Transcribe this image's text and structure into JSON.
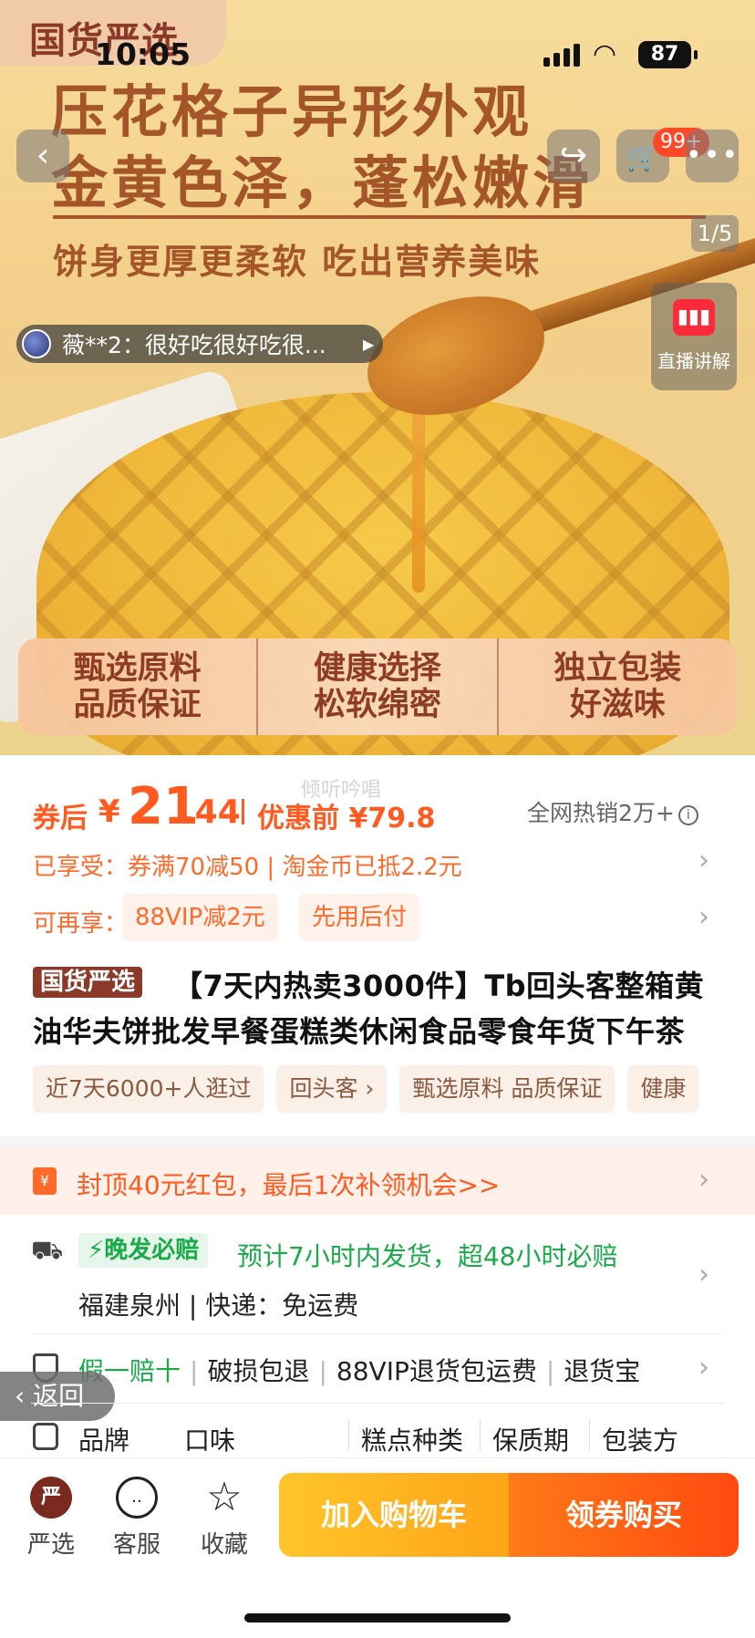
{
  "status_bar": {
    "time": "10:05",
    "battery": "87"
  },
  "hero": {
    "brand": "国货严选",
    "headline_1": "压花格子异形外观",
    "headline_2": "金黄色泽，蓬松嫩滑",
    "subheadline": "饼身更厚更柔软 吃出营养美味",
    "cart_badge": "99+",
    "page_counter": "1/5",
    "review": "薇**2：很好吃很好吃很...",
    "live_label": "直播讲解",
    "features": [
      {
        "line1": "甄选原料",
        "line2": "品质保证"
      },
      {
        "line1": "健康选择",
        "line2": "松软绵密"
      },
      {
        "line1": "独立包装",
        "line2": "好滋味"
      }
    ]
  },
  "price": {
    "after_coupon_label": "券后",
    "yen": "¥",
    "integer": "21",
    "decimal": ".44",
    "before_label": "优惠前 ¥79.8",
    "sold": "全网热销2万+",
    "watermark": "倾听吟唱"
  },
  "benefits": {
    "enjoyed": "已享受：券满70减50 | 淘金币已抵2.2元",
    "more_label": "可再享：",
    "chips": [
      "88VIP减2元",
      "先用后付"
    ]
  },
  "title": {
    "badge": "国货严选",
    "line1": "【7天内热卖3000件】Tb回头客整箱黄",
    "line2": "油华夫饼批发早餐蛋糕类休闲食品零食年货下午茶"
  },
  "tags": [
    "近7天6000+人逛过",
    "回头客 ›",
    "甄选原料 品质保证",
    "健康"
  ],
  "promo": {
    "text": "封顶40元红包，最后1次补领机会>>"
  },
  "shipping": {
    "badge": "⚡晚发必赔",
    "text": "预计7小时内发货，超48小时必赔",
    "origin": "福建泉州 | 快递：免运费"
  },
  "guarantee": {
    "items": [
      "假一赔十",
      "破损包退",
      "88VIP退货包运费",
      "退货宝"
    ]
  },
  "specs": [
    "品牌",
    "口味",
    "糕点种类",
    "保质期",
    "包装方"
  ],
  "back_pill": "‹ 返回",
  "bottom": {
    "nav": [
      {
        "label": "严选",
        "icon": "严"
      },
      {
        "label": "客服",
        "icon": "‥"
      },
      {
        "label": "收藏",
        "icon": "☆"
      }
    ],
    "add_cart": "加入购物车",
    "buy": "领券购买"
  }
}
